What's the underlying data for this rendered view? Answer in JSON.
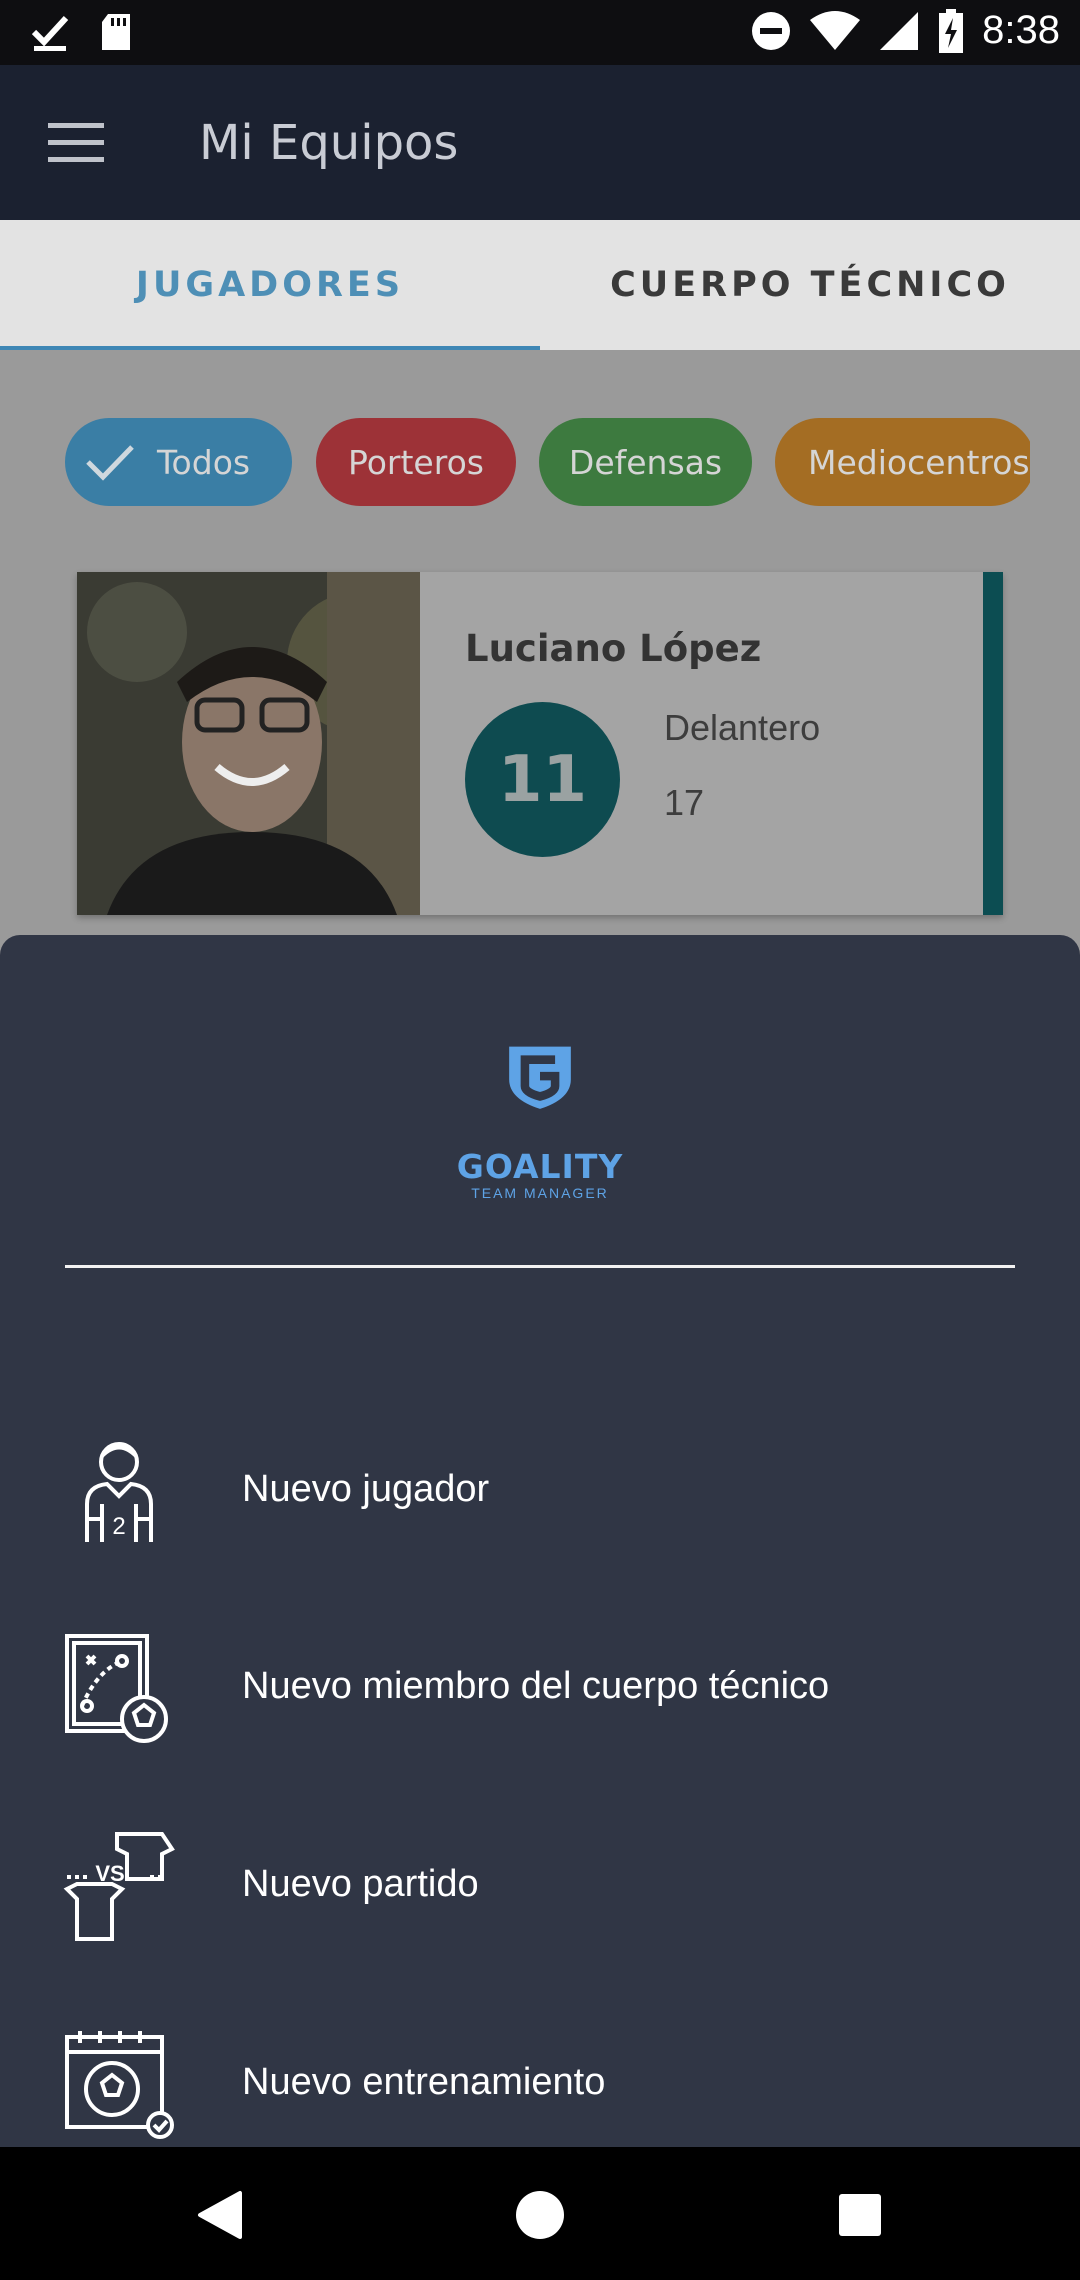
{
  "status_bar": {
    "time": "8:38",
    "icons": [
      "download-done-icon",
      "sd-card-icon",
      "do-not-disturb-icon",
      "wifi-icon",
      "signal-icon",
      "battery-charging-icon"
    ]
  },
  "app_bar": {
    "title": "Mi Equipos",
    "menu_icon": "hamburger-menu-icon"
  },
  "tabs": [
    {
      "label": "JUGADORES",
      "active": true
    },
    {
      "label": "CUERPO TÉCNICO",
      "active": false
    }
  ],
  "filter_chips": [
    {
      "label": "Todos",
      "selected": true,
      "color": "#3a7ea5"
    },
    {
      "label": "Porteros",
      "selected": false,
      "color": "#9d3237"
    },
    {
      "label": "Defensas",
      "selected": false,
      "color": "#3d7a3f"
    },
    {
      "label": "Mediocentros",
      "selected": false,
      "color": "#a46d23"
    }
  ],
  "player_card": {
    "name": "Luciano López",
    "number": "11",
    "position": "Delantero",
    "age": "17",
    "accent_color": "#0c4d52"
  },
  "bottom_sheet": {
    "logo_title": "GOALITY",
    "logo_subtitle": "TEAM MANAGER",
    "items": [
      {
        "label": "Nuevo jugador",
        "icon": "player-icon"
      },
      {
        "label": "Nuevo miembro del cuerpo técnico",
        "icon": "tactics-board-icon"
      },
      {
        "label": "Nuevo partido",
        "icon": "match-versus-icon"
      },
      {
        "label": "Nuevo entrenamiento",
        "icon": "training-calendar-icon"
      }
    ]
  },
  "nav_bar": {
    "buttons": [
      "back-icon",
      "home-icon",
      "recents-icon"
    ]
  }
}
